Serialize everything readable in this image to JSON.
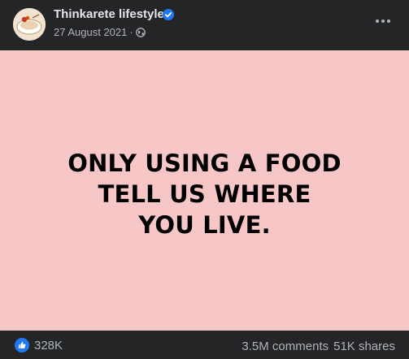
{
  "post": {
    "page_name": "Thinkarete lifestyle",
    "date": "27 August 2021",
    "separator": "·",
    "visibility_icon": "globe-icon",
    "verified_icon": "verified-badge-icon",
    "menu_icon": "more-options-icon"
  },
  "image": {
    "text": "ONLY USING A FOOD\nTELL US WHERE\nYOU LIVE.",
    "background": "#f7c6c7"
  },
  "footer": {
    "reaction_icon": "like-icon",
    "reaction_count": "328K",
    "comments": "3.5M comments",
    "shares": "51K shares"
  },
  "colors": {
    "background": "#242526",
    "primary_text": "#e4e6eb",
    "secondary_text": "#b0b3b8",
    "accent": "#2078f4"
  }
}
